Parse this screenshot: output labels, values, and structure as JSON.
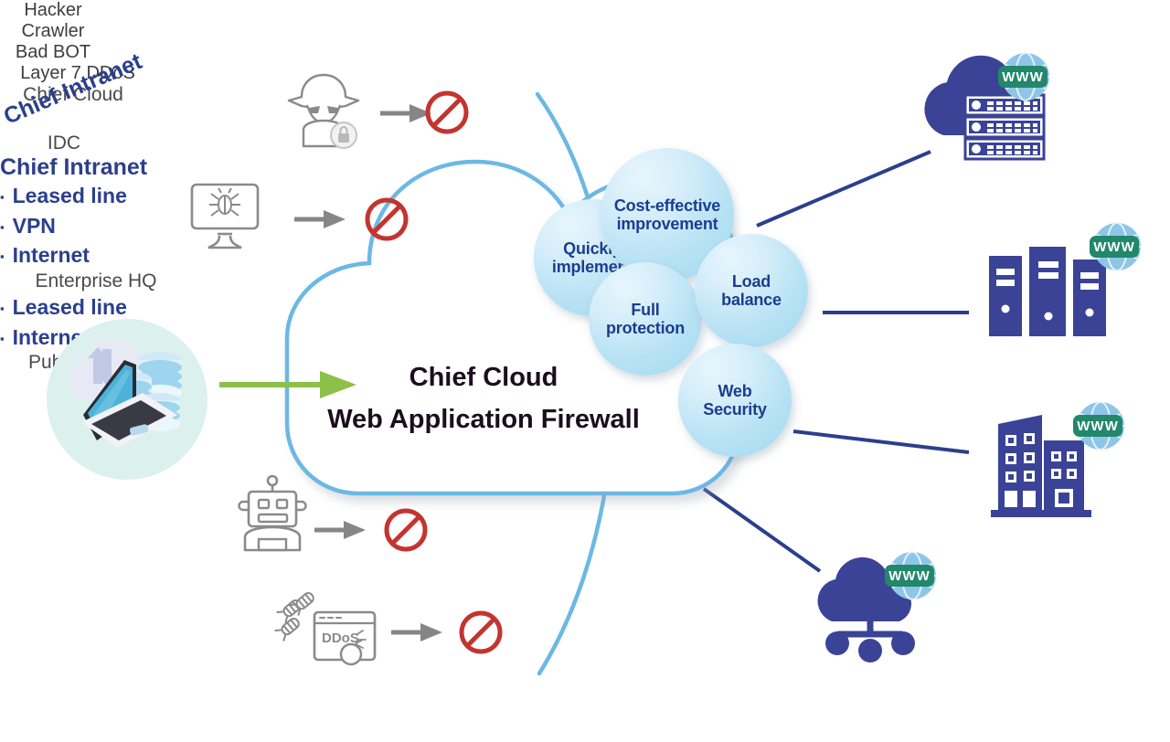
{
  "diagram": {
    "title": "Chief Cloud Web Application Firewall architecture",
    "colors": {
      "accent_blue": "#2b3f8c",
      "cloud_stroke": "#6cb8e4",
      "bubble_blue": "#a4d8ef",
      "bubble_text": "#1b3d8f",
      "deny_red": "#c4342f",
      "arrow_gray": "#868686",
      "arrow_green": "#8cc049",
      "icon_gray": "#8a8a8a",
      "caption_gray": "#4d4d4d",
      "www_green": "#22876b",
      "globe_blue": "#8fc6e8",
      "source_circle": "#dcf0ee"
    }
  },
  "source": {
    "label": "cloud-data-laptop"
  },
  "threats": [
    {
      "icon": "hacker-icon",
      "label": "Hacker"
    },
    {
      "icon": "crawler-icon",
      "label": "Crawler"
    },
    {
      "icon": "bad-bot-icon",
      "label": "Bad BOT"
    },
    {
      "icon": "layer7-ddos-icon",
      "label": "Layer 7 DDoS",
      "screen_text": "DDoS"
    }
  ],
  "waf": {
    "line1": "Chief Cloud",
    "line2": "Web Application Firewall"
  },
  "features": [
    {
      "id": "quickly-implement",
      "text": "Quickly\nimplement"
    },
    {
      "id": "cost-effective",
      "text": "Cost-effective\nimprovement"
    },
    {
      "id": "full-protection",
      "text": "Full\nprotection"
    },
    {
      "id": "load-balance",
      "text": "Load\nbalance"
    },
    {
      "id": "web-security",
      "text": "Web\nSecurity"
    }
  ],
  "connections": [
    {
      "id": "chief-cloud-link",
      "label": "Chief Intranet",
      "bullets": []
    },
    {
      "id": "idc-link",
      "label": "Chief Intranet",
      "bullets": [
        "Leased line",
        "VPN",
        "Internet"
      ]
    },
    {
      "id": "public-cloud-link",
      "label": "",
      "bullets": [
        "Leased line",
        "Internet"
      ]
    }
  ],
  "destinations": [
    {
      "id": "chief-cloud",
      "icon": "cloud-server-icon",
      "label": "Chief Cloud",
      "badge": "WWW"
    },
    {
      "id": "idc",
      "icon": "server-rack-icon",
      "label": "IDC",
      "badge": "WWW"
    },
    {
      "id": "enterprise-hq",
      "icon": "office-building-icon",
      "label": "Enterprise HQ",
      "badge": "WWW"
    },
    {
      "id": "public-cloud",
      "icon": "public-cloud-icon",
      "label": "Public Cloud",
      "badge": "WWW"
    }
  ]
}
